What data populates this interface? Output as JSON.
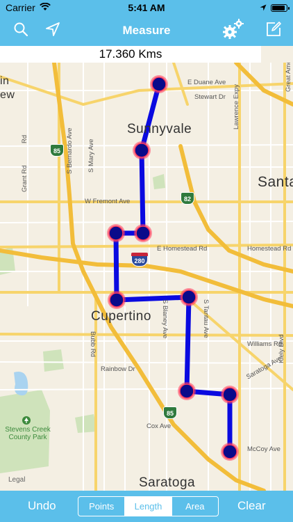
{
  "status": {
    "carrier": "Carrier",
    "time": "5:41 AM",
    "battery_level": 0.92,
    "icons": [
      "wifi-icon",
      "location-arrow-icon",
      "battery-icon"
    ]
  },
  "nav": {
    "title": "Measure",
    "icons": [
      "search-icon",
      "location-arrow-icon",
      "gears-icon",
      "edit-icon"
    ]
  },
  "distance": {
    "text": "17.360 Kms"
  },
  "map": {
    "cities": {
      "sunnyvale": "Sunnyvale",
      "cupertino": "Cupertino",
      "saratoga": "Saratoga",
      "santa": "Santa",
      "mountain_view_a": "in",
      "mountain_view_b": "ew"
    },
    "streets": {
      "e_duane": "E Duane Ave",
      "stewart": "Stewart Dr",
      "lawrence": "Lawrence Expy",
      "w_fremont": "W Fremont Ave",
      "e_homestead": "E Homestead Rd",
      "homestead": "Homestead Rd",
      "williams": "Williams Rd",
      "saratoga_ave": "Saratoga Ave",
      "mccoy": "McCoy Ave",
      "cox": "Cox Ave",
      "rainbow": "Rainbow Dr",
      "bubb": "Bubb Rd",
      "blaney": "S Blaney Ave",
      "tantau": "S Tantau Ave",
      "bernardo": "S Bernardo Ave",
      "mary": "S Mary Ave",
      "grant": "Grant Rd",
      "kiely": "Kiely Blvd",
      "great_america": "Great America",
      "rd_left": "Rd"
    },
    "shields": {
      "hwy85_a": "85",
      "hwy85_b": "85",
      "hwy82": "82",
      "i280": "280"
    },
    "park": "Stevens Creek County Park",
    "legal": "Legal"
  },
  "bottom": {
    "undo": "Undo",
    "clear": "Clear",
    "segments": [
      "Points",
      "Length",
      "Area"
    ],
    "selected_segment": "Length"
  },
  "colors": {
    "accent": "#5bbfea",
    "route": "#0a0ae0",
    "point_fill": "#0a0a8a",
    "point_glow": "#ff3b5c"
  }
}
